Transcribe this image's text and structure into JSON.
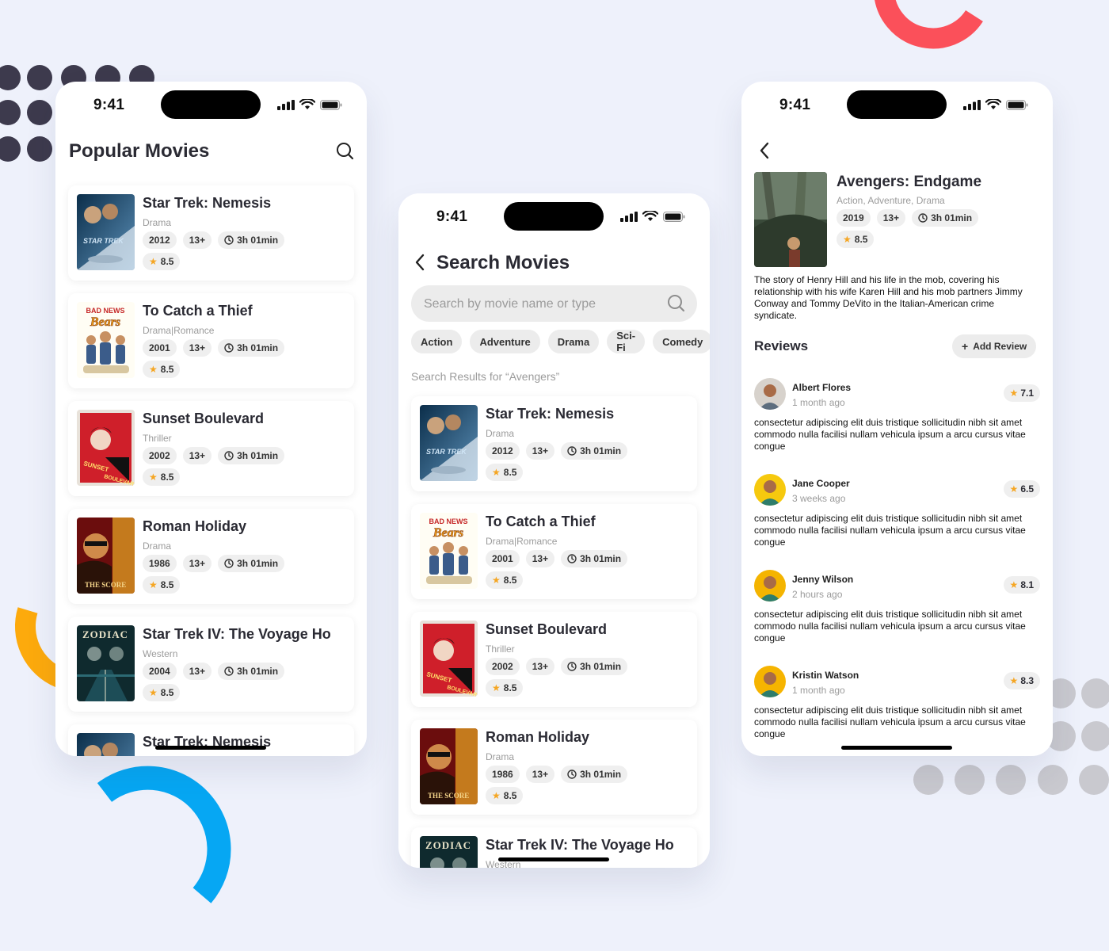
{
  "colors": {
    "background": "#eef1fb",
    "accent_red": "#fb505a",
    "accent_blue": "#06a7f3",
    "accent_orange": "#fdaa0c",
    "dot_dark": "#3d3a4d",
    "dot_grey": "#c9c9cf",
    "star": "#f5a623"
  },
  "status_bar": {
    "time": "9:41",
    "icons": [
      "cellular-icon",
      "wifi-icon",
      "battery-icon"
    ]
  },
  "popular": {
    "title": "Popular Movies",
    "movies": [
      {
        "title": "Star Trek: Nemesis",
        "genre": "Drama",
        "year": "2012",
        "age": "13+",
        "duration": "3h 01min",
        "rating": "8.5"
      },
      {
        "title": "To Catch a Thief",
        "genre": "Drama|Romance",
        "year": "2001",
        "age": "13+",
        "duration": "3h 01min",
        "rating": "8.5"
      },
      {
        "title": "Sunset Boulevard",
        "genre": "Thriller",
        "year": "2002",
        "age": "13+",
        "duration": "3h 01min",
        "rating": "8.5"
      },
      {
        "title": "Roman Holiday",
        "genre": "Drama",
        "year": "1986",
        "age": "13+",
        "duration": "3h 01min",
        "rating": "8.5"
      },
      {
        "title": "Star Trek IV: The Voyage Ho",
        "genre": "Western",
        "year": "2004",
        "age": "13+",
        "duration": "3h 01min",
        "rating": "8.5"
      },
      {
        "title": "Star Trek: Nemesis",
        "genre": "",
        "year": "",
        "age": "",
        "duration": "",
        "rating": ""
      }
    ]
  },
  "search": {
    "title": "Search Movies",
    "placeholder": "Search by movie name or type",
    "filters": [
      "Action",
      "Adventure",
      "Drama",
      "Sci-Fi",
      "Comedy"
    ],
    "results_label": "Search Results for “Avengers”",
    "movies": [
      {
        "title": "Star Trek: Nemesis",
        "genre": "Drama",
        "year": "2012",
        "age": "13+",
        "duration": "3h 01min",
        "rating": "8.5"
      },
      {
        "title": "To Catch a Thief",
        "genre": "Drama|Romance",
        "year": "2001",
        "age": "13+",
        "duration": "3h 01min",
        "rating": "8.5"
      },
      {
        "title": "Sunset Boulevard",
        "genre": "Thriller",
        "year": "2002",
        "age": "13+",
        "duration": "3h 01min",
        "rating": "8.5"
      },
      {
        "title": "Roman Holiday",
        "genre": "Drama",
        "year": "1986",
        "age": "13+",
        "duration": "3h 01min",
        "rating": "8.5"
      },
      {
        "title": "Star Trek IV: The Voyage Ho",
        "genre": "Western",
        "year": "",
        "age": "",
        "duration": "",
        "rating": ""
      }
    ]
  },
  "detail": {
    "title": "Avengers: Endgame",
    "genres": "Action, Adventure, Drama",
    "year": "2019",
    "age": "13+",
    "duration": "3h 01min",
    "rating": "8.5",
    "synopsis": "The story of Henry Hill and his life in the mob, covering his relationship with his wife Karen Hill and his mob partners Jimmy Conway and Tommy DeVito in the Italian-American crime syndicate.",
    "reviews_heading": "Reviews",
    "add_review_label": "Add Review",
    "reviews": [
      {
        "name": "Albert Flores",
        "time": "1 month ago",
        "score": "7.1",
        "text": "consectetur adipiscing elit duis tristique sollicitudin nibh sit amet commodo nulla facilisi nullam vehicula ipsum a arcu cursus vitae congue"
      },
      {
        "name": "Jane Cooper",
        "time": "3 weeks ago",
        "score": "6.5",
        "text": "consectetur adipiscing elit duis tristique sollicitudin nibh sit amet commodo nulla facilisi nullam vehicula ipsum a arcu cursus vitae congue"
      },
      {
        "name": "Jenny Wilson",
        "time": "2 hours ago",
        "score": "8.1",
        "text": "consectetur adipiscing elit duis tristique sollicitudin nibh sit amet commodo nulla facilisi nullam vehicula ipsum a arcu cursus vitae congue"
      },
      {
        "name": "Kristin Watson",
        "time": "1 month ago",
        "score": "8.3",
        "text": "consectetur adipiscing elit duis tristique sollicitudin nibh sit amet commodo nulla facilisi nullam vehicula ipsum a arcu cursus vitae congue"
      }
    ]
  },
  "poster_lettering": {
    "star_trek": "STAR TREK",
    "bad_news_bears": "BAD NEWS Bears",
    "sunset": "SUNSET BOULEVARD",
    "score": "THE SCORE",
    "zodiac": "ZODIAC"
  }
}
